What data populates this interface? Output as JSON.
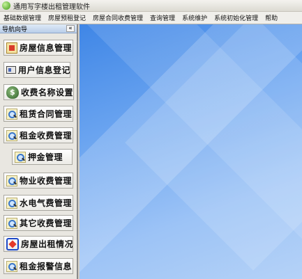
{
  "window": {
    "title": "通用写字楼出租管理软件"
  },
  "menu": [
    "基础数据管理",
    "房屋预租登记",
    "房屋合同收费管理",
    "查询管理",
    "系统维护",
    "系统初始化管理",
    "帮助"
  ],
  "sidebar": {
    "title": "导航向导",
    "collapse_label": "«",
    "items": [
      {
        "label": "房屋信息管理",
        "icon": "house-document-icon"
      },
      {
        "label": "用户信息登记",
        "icon": "id-card-icon"
      },
      {
        "label": "收费名称设置",
        "icon": "money-bag-icon"
      },
      {
        "label": "租赁合同管理",
        "icon": "magnifier-icon"
      },
      {
        "label": "租金收费管理",
        "icon": "magnifier-icon"
      },
      {
        "label": "押金管理",
        "icon": "magnifier-icon"
      },
      {
        "label": "物业收费管理",
        "icon": "magnifier-icon"
      },
      {
        "label": "水电气费管理",
        "icon": "magnifier-icon"
      },
      {
        "label": "其它收费管理",
        "icon": "magnifier-icon"
      },
      {
        "label": "房屋出租情况",
        "icon": "frame-icon"
      },
      {
        "label": "租金报警信息",
        "icon": "magnifier-icon"
      }
    ]
  }
}
